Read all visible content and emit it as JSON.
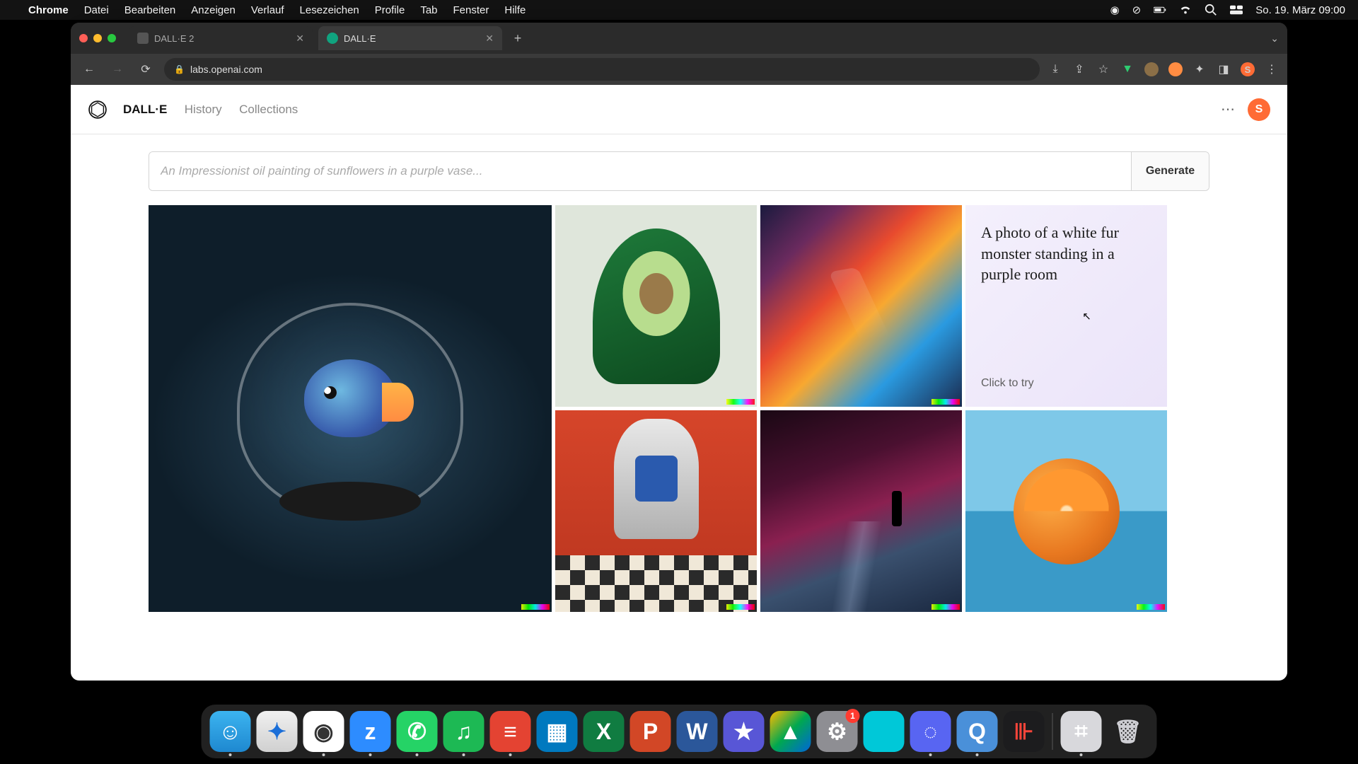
{
  "menubar": {
    "app": "Chrome",
    "items": [
      "Datei",
      "Bearbeiten",
      "Anzeigen",
      "Verlauf",
      "Lesezeichen",
      "Profile",
      "Tab",
      "Fenster",
      "Hilfe"
    ],
    "clock": "So. 19. März  09:00"
  },
  "tabs": [
    {
      "title": "DALL·E 2",
      "active": false
    },
    {
      "title": "DALL·E",
      "active": true
    }
  ],
  "omnibox": {
    "url": "labs.openai.com"
  },
  "nav": {
    "brand": "DALL·E",
    "items": [
      "History",
      "Collections"
    ],
    "avatar_initial": "S"
  },
  "prompt": {
    "placeholder": "An Impressionist oil painting of sunflowers in a purple vase...",
    "generate_label": "Generate"
  },
  "suggestion": {
    "text": "A photo of a white fur monster standing in a purple room",
    "cta": "Click to try"
  },
  "dock_badge": "1"
}
